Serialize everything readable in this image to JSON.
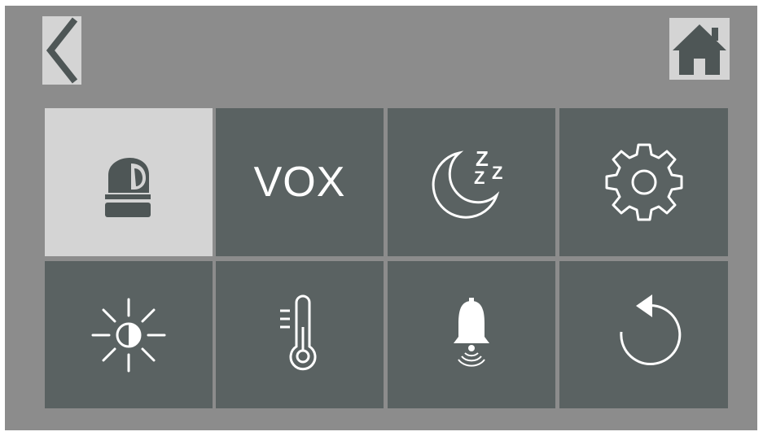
{
  "header": {
    "back_icon": "chevron-left-icon",
    "home_icon": "home-icon"
  },
  "menu": {
    "tiles": [
      {
        "icon": "camera-icon",
        "selected": true
      },
      {
        "label": "VOX",
        "icon": "vox-text"
      },
      {
        "icon": "sleep-moon-icon"
      },
      {
        "icon": "gear-icon"
      },
      {
        "icon": "brightness-icon"
      },
      {
        "icon": "thermometer-icon"
      },
      {
        "icon": "alarm-bell-icon"
      },
      {
        "icon": "reset-icon"
      }
    ]
  },
  "colors": {
    "screen_bg": "#8c8c8c",
    "tile_bg": "#5a6262",
    "selected_tile_bg": "#d4d4d4",
    "icon_light": "#ffffff",
    "icon_dark": "#4e5656"
  }
}
